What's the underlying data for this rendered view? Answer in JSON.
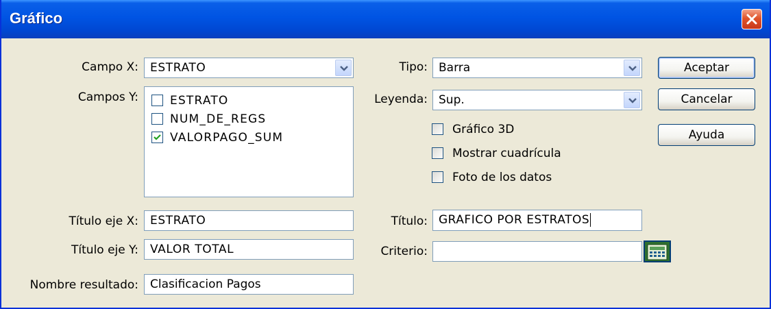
{
  "window": {
    "title": "Gráfico"
  },
  "left": {
    "campo_x": {
      "label": "Campo X:",
      "value": "ESTRATO"
    },
    "campos_y": {
      "label": "Campos Y:",
      "items": [
        {
          "label": "ESTRATO",
          "checked": false
        },
        {
          "label": "NUM_DE_REGS",
          "checked": false
        },
        {
          "label": "VALORPAGO_SUM",
          "checked": true
        }
      ]
    },
    "titulo_eje_x": {
      "label": "Título eje X:",
      "value": "ESTRATO"
    },
    "titulo_eje_y": {
      "label": "Título eje Y:",
      "value": "VALOR TOTAL"
    },
    "nombre_resultado": {
      "label": "Nombre resultado:",
      "value": "Clasificacion Pagos"
    }
  },
  "right": {
    "tipo": {
      "label": "Tipo:",
      "value": "Barra"
    },
    "leyenda": {
      "label": "Leyenda:",
      "value": "Sup."
    },
    "options": [
      {
        "label": "Gráfico 3D",
        "checked": false
      },
      {
        "label": "Mostrar cuadrícula",
        "checked": false
      },
      {
        "label": "Foto de los datos",
        "checked": false
      }
    ],
    "titulo": {
      "label": "Título:",
      "value": "GRAFICO POR ESTRATOS"
    },
    "criterio": {
      "label": "Criterio:",
      "value": ""
    }
  },
  "buttons": {
    "aceptar": "Aceptar",
    "cancelar": "Cancelar",
    "ayuda": "Ayuda"
  },
  "colors": {
    "titlebar": "#0054e3",
    "face": "#ece9d8",
    "border": "#7f9db9",
    "close": "#e0542b"
  }
}
